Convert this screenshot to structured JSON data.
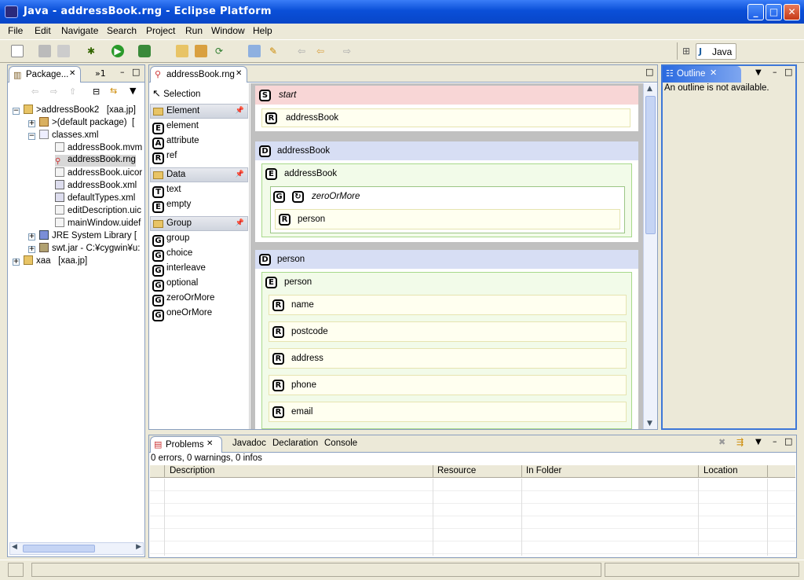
{
  "window": {
    "title": "Java - addressBook.rng - Eclipse Platform"
  },
  "menu": [
    "File",
    "Edit",
    "Navigate",
    "Search",
    "Project",
    "Run",
    "Window",
    "Help"
  ],
  "perspective": {
    "label": "Java"
  },
  "package_explorer": {
    "tab": "Package...",
    "tab2": "»1",
    "items": [
      {
        "label": ">addressBook2",
        "tag": "[xaa.jp]"
      },
      {
        "label": ">(default package)",
        "tag": "["
      },
      {
        "label": "classes.xml"
      },
      {
        "label": "addressBook.mvm"
      },
      {
        "label": "addressBook.rng"
      },
      {
        "label": "addressBook.uicor"
      },
      {
        "label": "addressBook.xml"
      },
      {
        "label": "defaultTypes.xml"
      },
      {
        "label": "editDescription.uic"
      },
      {
        "label": "mainWindow.uidef"
      },
      {
        "label": "JRE System Library",
        "tag": "["
      },
      {
        "label": "swt.jar - C:¥cygwin¥u:"
      },
      {
        "label": "xaa",
        "tag": "[xaa.jp]"
      }
    ]
  },
  "editor": {
    "tab": "addressBook.rng"
  },
  "palette": {
    "selection": "Selection",
    "groups": [
      {
        "name": "Element",
        "items": [
          {
            "badge": "E",
            "label": "element"
          },
          {
            "badge": "A",
            "label": "attribute"
          },
          {
            "badge": "R",
            "label": "ref"
          }
        ]
      },
      {
        "name": "Data",
        "items": [
          {
            "badge": "T",
            "label": "text"
          },
          {
            "badge": "E",
            "label": "empty"
          }
        ]
      },
      {
        "name": "Group",
        "items": [
          {
            "badge": "G",
            "label": "group"
          },
          {
            "badge": "G",
            "label": "choice"
          },
          {
            "badge": "G",
            "label": "interleave"
          },
          {
            "badge": "G",
            "label": "optional"
          },
          {
            "badge": "G",
            "label": "zeroOrMore"
          },
          {
            "badge": "G",
            "label": "oneOrMore"
          }
        ]
      }
    ]
  },
  "canvas": {
    "start": {
      "badge": "S",
      "label": "start",
      "ref": {
        "badge": "R",
        "label": "addressBook"
      }
    },
    "def1": {
      "badge": "D",
      "label": "addressBook",
      "element": {
        "badge": "E",
        "label": "addressBook"
      },
      "group": {
        "badge": "G",
        "label": "zeroOrMore"
      },
      "ref": {
        "badge": "R",
        "label": "person"
      }
    },
    "def2": {
      "badge": "D",
      "label": "person",
      "element": {
        "badge": "E",
        "label": "person"
      },
      "refs": [
        {
          "badge": "R",
          "label": "name"
        },
        {
          "badge": "R",
          "label": "postcode"
        },
        {
          "badge": "R",
          "label": "address"
        },
        {
          "badge": "R",
          "label": "phone"
        },
        {
          "badge": "R",
          "label": "email"
        }
      ]
    }
  },
  "outline": {
    "tab": "Outline",
    "message": "An outline is not available."
  },
  "problems": {
    "tabs": [
      "Problems",
      "Javadoc",
      "Declaration",
      "Console"
    ],
    "summary": "0 errors, 0 warnings, 0 infos",
    "columns": [
      "Description",
      "Resource",
      "In Folder",
      "Location"
    ]
  }
}
